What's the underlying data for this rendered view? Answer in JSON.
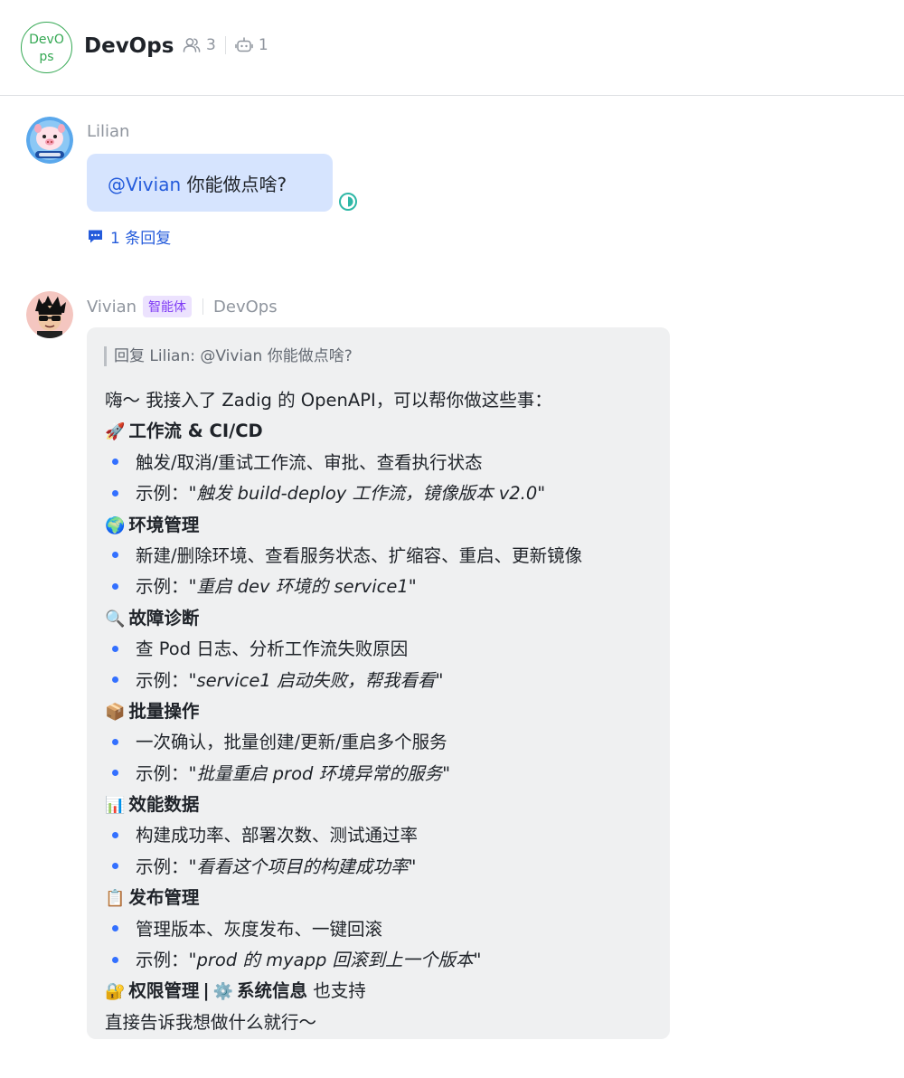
{
  "header": {
    "group_avatar_text": "DevOps",
    "title": "DevOps",
    "member_count": "3",
    "bot_count": "1"
  },
  "messages": [
    {
      "sender": "Lilian",
      "mention": "@Vivian",
      "text": " 你能做点啥?",
      "reply_count_label": "1 条回复"
    },
    {
      "sender": "Vivian",
      "tag": "智能体",
      "group": "DevOps",
      "quote": "回复 Lilian: @Vivian 你能做点啥?",
      "intro": "嗨～ 我接入了 Zadig 的 OpenAPI，可以帮你做这些事：",
      "sections": [
        {
          "emoji": "🚀",
          "title": "工作流 & CI/CD",
          "desc": "触发/取消/重试工作流、审批、查看执行状态",
          "example_prefix": "示例：",
          "example": "\"触发 build-deploy 工作流，镜像版本 v2.0\""
        },
        {
          "emoji": "🌍",
          "title": "环境管理",
          "desc": "新建/删除环境、查看服务状态、扩缩容、重启、更新镜像",
          "example_prefix": "示例：",
          "example": "\"重启 dev 环境的 service1\""
        },
        {
          "emoji": "🔍",
          "title": "故障诊断",
          "desc": "查 Pod 日志、分析工作流失败原因",
          "example_prefix": "示例：",
          "example": "\"service1 启动失败，帮我看看\""
        },
        {
          "emoji": "📦",
          "title": "批量操作",
          "desc": "一次确认，批量创建/更新/重启多个服务",
          "example_prefix": "示例：",
          "example": "\"批量重启 prod 环境异常的服务\""
        },
        {
          "emoji": "📊",
          "title": "效能数据",
          "desc": "构建成功率、部署次数、测试通过率",
          "example_prefix": "示例：",
          "example": "\"看看这个项目的构建成功率\""
        },
        {
          "emoji": "📋",
          "title": "发布管理",
          "desc": "管理版本、灰度发布、一键回滚",
          "example_prefix": "示例：",
          "example": "\"prod 的 myapp 回滚到上一个版本\""
        }
      ],
      "extra": {
        "emoji1": "🔐",
        "title1": "权限管理",
        "separator": "|",
        "emoji2": "⚙️",
        "title2": "系统信息",
        "suffix": " 也支持"
      },
      "closing": "直接告诉我想做什么就行～"
    }
  ],
  "colors": {
    "accent_blue": "#245bdb",
    "bullet_blue": "#3370ff",
    "bot_tag_bg": "#ece2fe",
    "bot_tag_text": "#7f3bf5",
    "group_green": "#34a853",
    "read_status_teal": "#2db7a6"
  }
}
